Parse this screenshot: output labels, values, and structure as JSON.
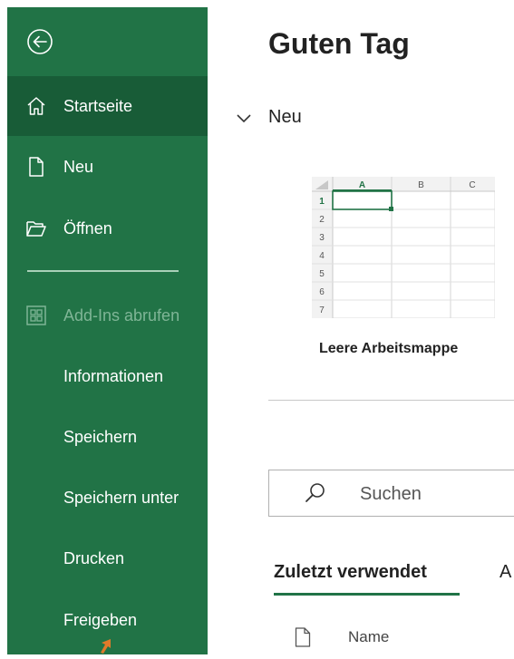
{
  "sidebar": {
    "back_icon": "back-arrow-icon",
    "items": [
      {
        "label": "Startseite",
        "icon": "home-icon",
        "active": true
      },
      {
        "label": "Neu",
        "icon": "new-document-icon"
      },
      {
        "label": "Öffnen",
        "icon": "open-folder-icon"
      },
      {
        "label": "Add-Ins abrufen",
        "icon": "add-ins-grid-icon",
        "disabled": true
      },
      {
        "label": "Informationen"
      },
      {
        "label": "Speichern"
      },
      {
        "label": "Speichern unter"
      },
      {
        "label": "Drucken"
      },
      {
        "label": "Freigeben"
      }
    ]
  },
  "main": {
    "title": "Guten Tag",
    "section_label": "Neu",
    "template": {
      "label": "Leere Arbeitsmappe",
      "columns": [
        "A",
        "B",
        "C"
      ],
      "rows": [
        "1",
        "2",
        "3",
        "4",
        "5",
        "6",
        "7"
      ]
    },
    "search": {
      "placeholder": "Suchen"
    },
    "tabs": {
      "recent": "Zuletzt verwendet",
      "other": "A"
    },
    "list_header": {
      "name": "Name"
    }
  },
  "colors": {
    "sidebar_bg": "#217346",
    "sidebar_active": "#185c37",
    "accent": "#217346",
    "cursor": "#e07a2a"
  }
}
